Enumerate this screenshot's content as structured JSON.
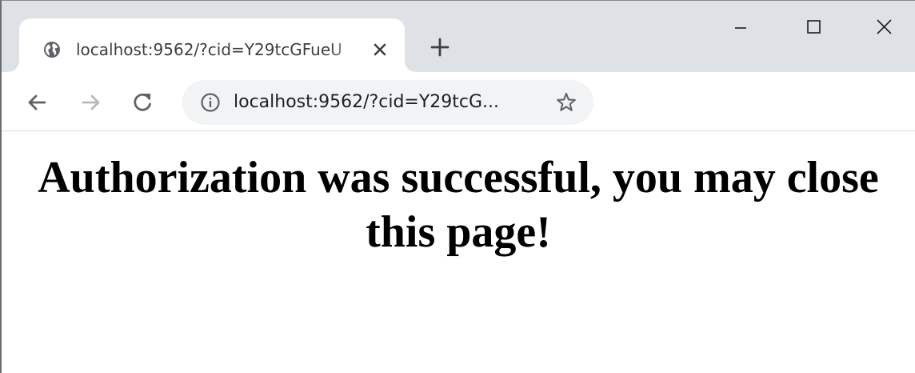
{
  "browser": {
    "tab": {
      "title": "localhost:9562/?cid=Y29tcGFueU",
      "favicon": "globe-icon"
    },
    "new_tab_icon": "plus-icon",
    "window_controls": [
      "minimize-icon",
      "maximize-icon",
      "close-icon"
    ],
    "toolbar": {
      "back_icon": "arrow-left-icon",
      "forward_icon": "arrow-right-icon",
      "reload_icon": "reload-icon"
    },
    "omnibox": {
      "info_icon": "info-icon",
      "url": "localhost:9562/?cid=Y29tcG...",
      "bookmark_icon": "star-icon"
    },
    "colors": {
      "tabstrip": "#dee1e6",
      "omnibox": "#f1f3f4",
      "icon": "#5f6368",
      "icon_disabled": "#b8babd"
    }
  },
  "page": {
    "heading": "Authorization was successful, you may close this page!"
  }
}
